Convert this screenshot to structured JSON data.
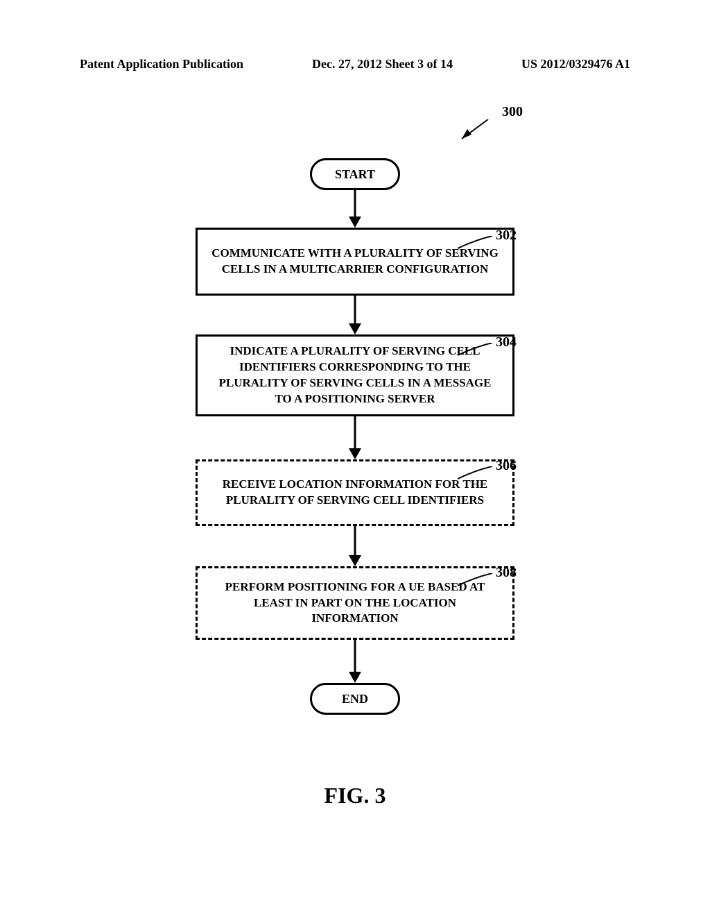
{
  "header": {
    "left": "Patent Application Publication",
    "mid": "Dec. 27, 2012  Sheet 3 of 14",
    "right": "US 2012/0329476 A1"
  },
  "diagram": {
    "ref_main": "300",
    "start": "START",
    "end": "END",
    "caption": "FIG. 3",
    "steps": [
      {
        "ref": "302",
        "text": "COMMUNICATE WITH A PLURALITY OF SERVING CELLS IN A MULTICARRIER CONFIGURATION",
        "dashed": false
      },
      {
        "ref": "304",
        "text": "INDICATE A PLURALITY OF SERVING CELL IDENTIFIERS CORRESPONDING TO THE PLURALITY OF SERVING CELLS IN A MESSAGE TO A POSITIONING SERVER",
        "dashed": false
      },
      {
        "ref": "306",
        "text": "RECEIVE LOCATION INFORMATION FOR THE PLURALITY OF SERVING CELL IDENTIFIERS",
        "dashed": true
      },
      {
        "ref": "308",
        "text": "PERFORM POSITIONING FOR A UE BASED AT LEAST IN PART ON THE LOCATION INFORMATION",
        "dashed": true
      }
    ]
  },
  "chart_data": {
    "type": "flowchart",
    "title": "FIG. 3",
    "ref": "300",
    "nodes": [
      {
        "id": "start",
        "type": "terminator",
        "label": "START"
      },
      {
        "id": "302",
        "type": "process",
        "label": "COMMUNICATE WITH A PLURALITY OF SERVING CELLS IN A MULTICARRIER CONFIGURATION"
      },
      {
        "id": "304",
        "type": "process",
        "label": "INDICATE A PLURALITY OF SERVING CELL IDENTIFIERS CORRESPONDING TO THE PLURALITY OF SERVING CELLS IN A MESSAGE TO A POSITIONING SERVER"
      },
      {
        "id": "306",
        "type": "process-optional",
        "label": "RECEIVE LOCATION INFORMATION FOR THE PLURALITY OF SERVING CELL IDENTIFIERS"
      },
      {
        "id": "308",
        "type": "process-optional",
        "label": "PERFORM POSITIONING FOR A UE BASED AT LEAST IN PART ON THE LOCATION INFORMATION"
      },
      {
        "id": "end",
        "type": "terminator",
        "label": "END"
      }
    ],
    "edges": [
      {
        "from": "start",
        "to": "302"
      },
      {
        "from": "302",
        "to": "304"
      },
      {
        "from": "304",
        "to": "306"
      },
      {
        "from": "306",
        "to": "308"
      },
      {
        "from": "308",
        "to": "end"
      }
    ]
  }
}
